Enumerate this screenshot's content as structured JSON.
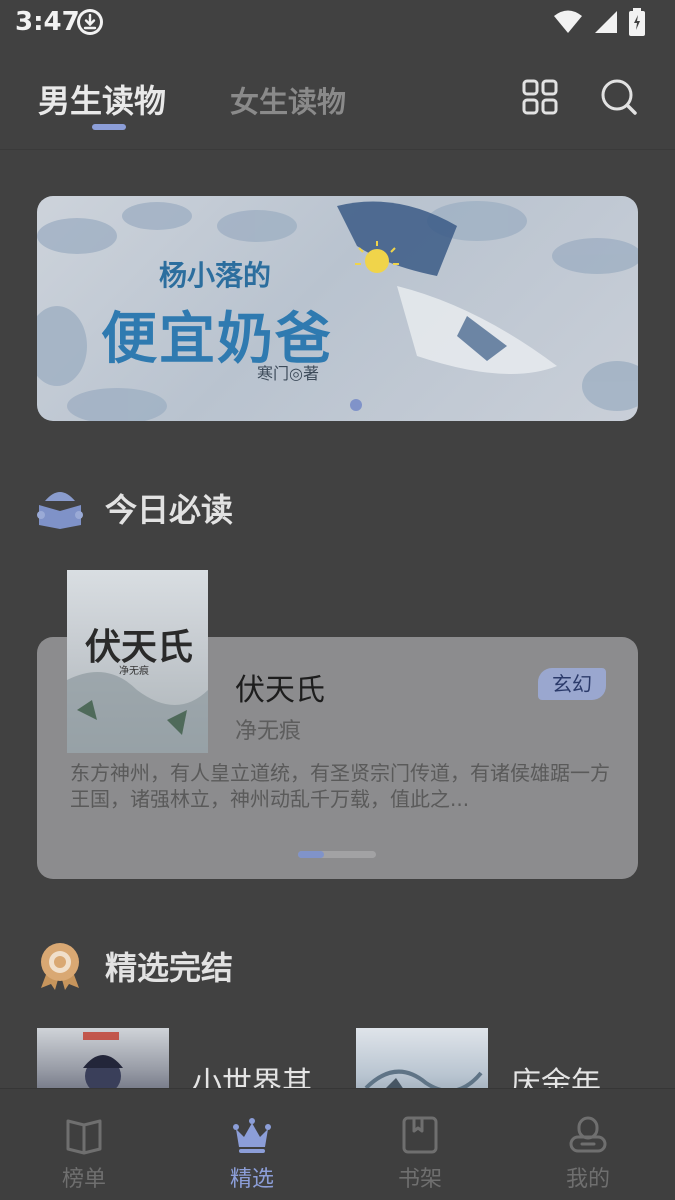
{
  "status_bar": {
    "time": "3:47"
  },
  "header": {
    "tabs": [
      {
        "label": "男生读物",
        "active": true
      },
      {
        "label": "女生读物",
        "active": false
      }
    ],
    "icons": [
      "grid-icon",
      "search-icon"
    ]
  },
  "banner": {
    "title_small": "杨小落的",
    "title_large": "便宜奶爸",
    "author_line": "寒门◎著"
  },
  "today": {
    "section_label": "今日必读",
    "book": {
      "cover_title": "伏天氏",
      "cover_author": "净无痕",
      "title": "伏天氏",
      "author": "净无痕",
      "tag": "玄幻",
      "description": "东方神州，有人皇立道统，有圣贤宗门传道，有诸侯雄踞一方王国，诸强林立，神州动乱千万载，值此之..."
    }
  },
  "finished": {
    "section_label": "精选完结",
    "items": [
      {
        "title": "小世界其"
      },
      {
        "title": "庆余年"
      }
    ]
  },
  "bottom_nav": {
    "items": [
      {
        "label": "榜单",
        "icon": "book-open-icon",
        "active": false
      },
      {
        "label": "精选",
        "icon": "crown-icon",
        "active": true
      },
      {
        "label": "书架",
        "icon": "bookshelf-icon",
        "active": false
      },
      {
        "label": "我的",
        "icon": "profile-icon",
        "active": false
      }
    ]
  },
  "colors": {
    "accent": "#8c9ed8",
    "background": "#414141",
    "card": "#8c8c8e"
  }
}
